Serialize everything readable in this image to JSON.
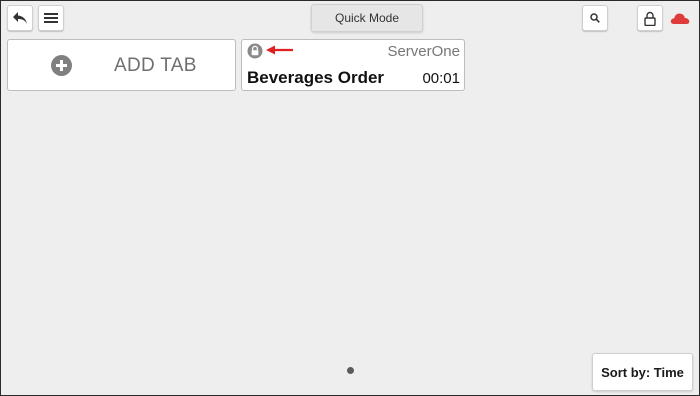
{
  "toolbar": {
    "back_icon": "back-arrow-icon",
    "menu_icon": "hamburger-menu-icon",
    "quick_mode_label": "Quick Mode",
    "search_icon": "search-icon",
    "lock_icon": "lock-icon",
    "cloud_icon": "cloud-icon",
    "cloud_color": "#e03b3b"
  },
  "add_tab": {
    "label": "ADD TAB",
    "icon": "plus-circle-icon"
  },
  "tabs": [
    {
      "server": "ServerOne",
      "title": "Beverages Order",
      "time": "00:01",
      "locked": true,
      "lock_icon": "lock-badge-icon",
      "annotation_icon": "red-arrow-icon",
      "annotation_color": "#e02020"
    }
  ],
  "pagination": {
    "pages": 1,
    "current": 1
  },
  "sort": {
    "label": "Sort by: Time"
  },
  "colors": {
    "background": "#eeeeee",
    "card": "#ffffff",
    "cloud": "#e03b3b",
    "annotation_arrow": "#e02020"
  }
}
